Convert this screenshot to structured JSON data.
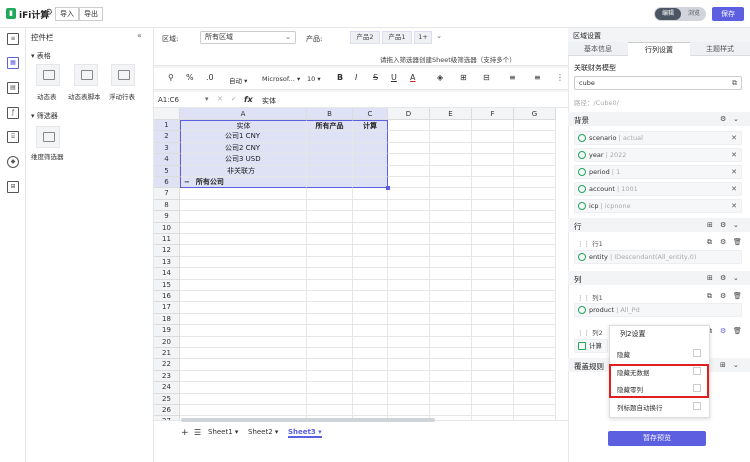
{
  "app": {
    "title": "iFi计算",
    "import_label": "导入",
    "export_label": "导出",
    "mode_edit": "编辑",
    "mode_view": "浏览",
    "save_label": "保存"
  },
  "widget_panel": {
    "title": "控件栏",
    "collapse": "«",
    "section_table": "表格",
    "widgets": [
      "动态表",
      "动态表脚本",
      "浮动行表"
    ],
    "section_filter": "筛选器",
    "filter_widgets": [
      "维度筛选器"
    ]
  },
  "filter_bar": {
    "region_label": "区域:",
    "region_value": "所有区域",
    "product_label": "产品:",
    "chips": [
      "产品2",
      "产品1",
      "1+"
    ],
    "hint": "请拖入筛选器创建Sheet级筛选器（支持多个）"
  },
  "toolbar": {
    "format_value": "自动",
    "font_value": "Microsof...",
    "font_size": "10",
    "bold": "B",
    "italic": "I",
    "strike": "S",
    "underline": "U",
    "font_color": "A"
  },
  "formula": {
    "cell_ref": "A1:C6",
    "fx": "fx",
    "value": "实体"
  },
  "grid": {
    "columns": [
      "A",
      "B",
      "C",
      "D",
      "E",
      "F",
      "G"
    ],
    "rows": [
      "1",
      "2",
      "3",
      "4",
      "5",
      "6",
      "7",
      "8",
      "9",
      "10",
      "11",
      "12",
      "13",
      "14",
      "15",
      "16",
      "17",
      "18",
      "19",
      "20",
      "21",
      "22",
      "23",
      "24",
      "25",
      "26",
      "27"
    ],
    "cells": {
      "A1": "实体",
      "B1": "所有产品",
      "C1": "计算",
      "A2": "公司1 CNY",
      "A3": "公司2 CNY",
      "A4": "公司3 USD",
      "A5": "非关联方",
      "A6": "所有公司",
      "A6_prefix": "−"
    }
  },
  "sheets": {
    "add": "+",
    "menu": "☰",
    "tabs": [
      "Sheet1",
      "Sheet2",
      "Sheet3"
    ],
    "active": "Sheet3"
  },
  "right_panel": {
    "header": "区域设置",
    "tabs": [
      "基本信息",
      "行列设置",
      "主题样式"
    ],
    "model_label": "关联财务模型",
    "model_value": "cube",
    "path": "路径：/Cube0/",
    "section_background": "背景",
    "background_fields": [
      {
        "name": "scenario",
        "value": "actual"
      },
      {
        "name": "year",
        "value": "2022"
      },
      {
        "name": "period",
        "value": "1"
      },
      {
        "name": "account",
        "value": "1001"
      },
      {
        "name": "icp",
        "value": "icpnone"
      }
    ],
    "section_row": "行",
    "row_item": "行1",
    "row_field": {
      "name": "entity",
      "value": "IDescendant(All_entity,0)"
    },
    "section_col": "列",
    "col_item1": "列1",
    "col_field1": {
      "name": "product",
      "value": "All_Pd"
    },
    "col_item2": "列2",
    "col_field2": "计算",
    "section_cover": "覆盖规则",
    "preview_label": "暂存预览"
  },
  "popup": {
    "title": "列2设置",
    "items": [
      "隐藏",
      "隐藏无数据",
      "隐藏零列",
      "列标题自动换行"
    ]
  },
  "colors": {
    "accent": "#5b5fe0",
    "selection": "#dfe2f5",
    "highlight": "#e02020",
    "check": "#22a85a"
  }
}
